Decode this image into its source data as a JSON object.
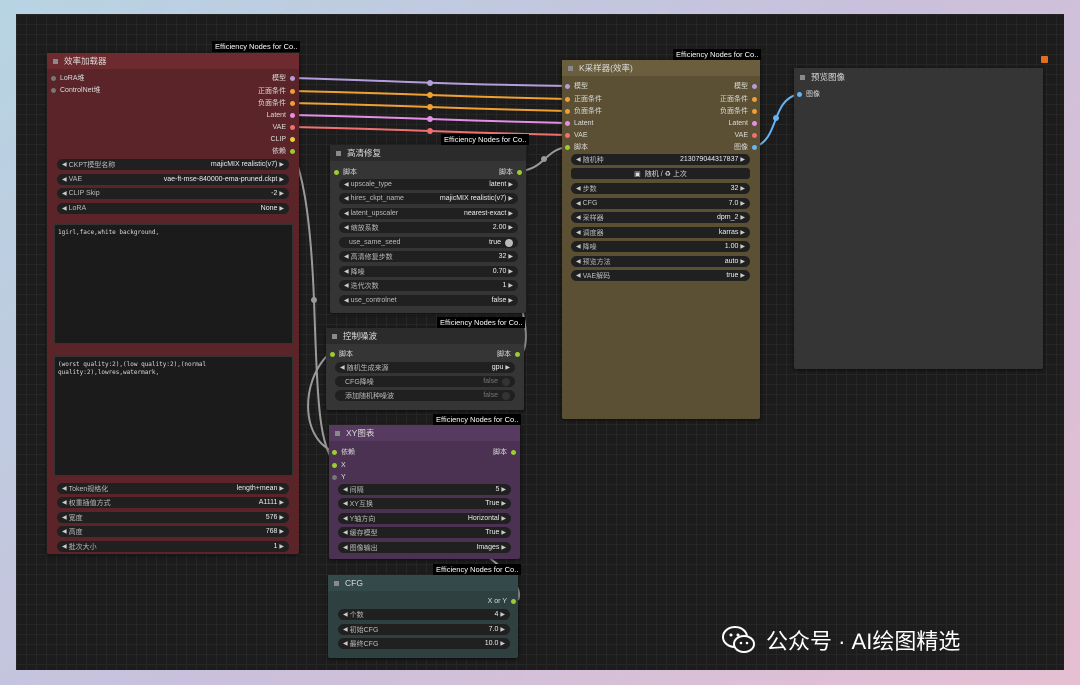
{
  "colors": {
    "canvas": "#1c1c1c",
    "loader": "#5a2428",
    "loader_head": "#6e2b2f",
    "ksampler": "#5c5034",
    "ksampler_head": "#6a5e3e",
    "gray_node": "#353535",
    "gray_head": "#2b2b2b",
    "xy": "#4b3252",
    "xy_head": "#573a5f",
    "cfg": "#2f4040",
    "cfg_head": "#34494a"
  },
  "tag": "Efficiency Nodes for Co..",
  "loader": {
    "title": "效率加载器",
    "inputs": [
      "LoRA堆",
      "ControlNet堆"
    ],
    "outputs": [
      "模型",
      "正面条件",
      "负面条件",
      "Latent",
      "VAE",
      "CLIP",
      "依赖"
    ],
    "widgets": [
      {
        "label": "CKPT模型名称",
        "value": "majicMIX realistic(v7)"
      },
      {
        "label": "VAE",
        "value": "vae-ft-mse-840000-ema-pruned.ckpt"
      },
      {
        "label": "CLIP Skip",
        "value": "-2"
      },
      {
        "label": "LoRA",
        "value": "None"
      }
    ],
    "positive_prompt": "1girl,face,white background,",
    "negative_prompt": "(worst quality:2),(low quality:2),(normal quality:2),lowres,watermark,",
    "widgets2": [
      {
        "label": "Token规格化",
        "value": "length+mean"
      },
      {
        "label": "权重插值方式",
        "value": "A1111"
      },
      {
        "label": "宽度",
        "value": "576"
      },
      {
        "label": "高度",
        "value": "768"
      },
      {
        "label": "批次大小",
        "value": "1"
      }
    ]
  },
  "hires": {
    "title": "高清修复",
    "input": "脚本",
    "output": "脚本",
    "widgets": [
      {
        "label": "upscale_type",
        "value": "latent"
      },
      {
        "label": "hires_ckpt_name",
        "value": "majicMIX realistic(v7)"
      },
      {
        "label": "latent_upscaler",
        "value": "nearest-exact"
      },
      {
        "label": "缩放系数",
        "value": "2.00"
      }
    ],
    "toggle": {
      "label": "use_same_seed",
      "value": "true"
    },
    "widgets2": [
      {
        "label": "高清修复步数",
        "value": "32"
      },
      {
        "label": "降噪",
        "value": "0.70"
      },
      {
        "label": "迭代次数",
        "value": "1"
      },
      {
        "label": "use_controlnet",
        "value": "false"
      }
    ]
  },
  "noise": {
    "title": "控制噪波",
    "input": "脚本",
    "output": "脚本",
    "widget": {
      "label": "随机生成来源",
      "value": "gpu"
    },
    "toggles": [
      {
        "label": "CFG降噪",
        "value": "false"
      },
      {
        "label": "添加随机种噪波",
        "value": "false"
      }
    ]
  },
  "xy": {
    "title": "XY图表",
    "inputs": [
      "依赖",
      "X",
      "Y"
    ],
    "output": "脚本",
    "widgets": [
      {
        "label": "间隔",
        "value": "5"
      },
      {
        "label": "XY互换",
        "value": "True"
      },
      {
        "label": "Y轴方向",
        "value": "Horizontal"
      },
      {
        "label": "缓存模型",
        "value": "True"
      },
      {
        "label": "图像输出",
        "value": "Images"
      }
    ]
  },
  "cfg": {
    "title": "CFG",
    "output": "X or Y",
    "widgets": [
      {
        "label": "个数",
        "value": "4"
      },
      {
        "label": "初始CFG",
        "value": "7.0"
      },
      {
        "label": "最终CFG",
        "value": "10.0"
      }
    ]
  },
  "ksampler": {
    "title": "K采样器(效率)",
    "inputs": [
      "模型",
      "正面条件",
      "负面条件",
      "Latent",
      "VAE",
      "脚本"
    ],
    "outputs": [
      "模型",
      "正面条件",
      "负面条件",
      "Latent",
      "VAE",
      "图像"
    ],
    "seed": {
      "label": "随机种",
      "value": "213079044317837"
    },
    "seed_button": "随机 / ♻ 上次",
    "widgets": [
      {
        "label": "步数",
        "value": "32"
      },
      {
        "label": "CFG",
        "value": "7.0"
      },
      {
        "label": "采样器",
        "value": "dpm_2"
      },
      {
        "label": "调度器",
        "value": "karras"
      },
      {
        "label": "降噪",
        "value": "1.00"
      },
      {
        "label": "预览方法",
        "value": "auto"
      },
      {
        "label": "VAE解码",
        "value": "true"
      }
    ]
  },
  "preview": {
    "title": "预览图像",
    "input": "图像"
  },
  "watermark": "公众号 · AI绘图精选"
}
